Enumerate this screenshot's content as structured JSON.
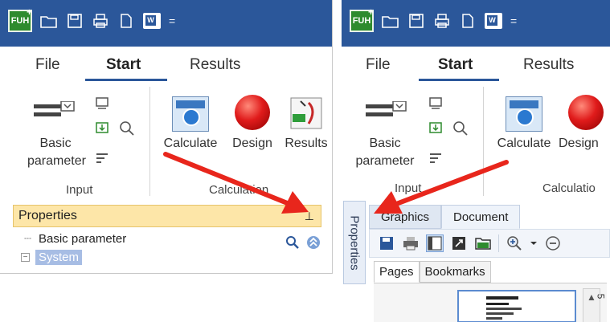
{
  "left": {
    "qat": {
      "logo": "FUH",
      "logo_plus": "+",
      "caret": "="
    },
    "tabs": [
      {
        "label": "File"
      },
      {
        "label": "Start"
      },
      {
        "label": "Results"
      }
    ],
    "ribbon": {
      "basic_parameter": "Basic\nparameter",
      "calculate": "Calculate",
      "design": "Design",
      "results": "Results",
      "group_input": "Input",
      "group_calculation": "Calculation"
    },
    "properties": {
      "title": "Properties",
      "pin": "⊥"
    },
    "tree": {
      "item1": "Basic parameter",
      "item2": "System"
    }
  },
  "right": {
    "qat": {
      "logo": "FUH",
      "logo_plus": "+",
      "caret": "="
    },
    "tabs": [
      {
        "label": "File"
      },
      {
        "label": "Start"
      },
      {
        "label": "Results"
      }
    ],
    "ribbon": {
      "basic_parameter": "Basic\nparameter",
      "calculate": "Calculate",
      "design": "Design",
      "group_input": "Input",
      "group_calculation": "Calculatio"
    },
    "vertical_tab": "Properties",
    "subtabs": [
      {
        "label": "Graphics"
      },
      {
        "label": "Document"
      }
    ],
    "page_tabs": [
      {
        "label": "Pages"
      },
      {
        "label": "Bookmarks"
      }
    ],
    "side_number": "5"
  },
  "colors": {
    "accent": "#2b579a",
    "properties_bar": "#fde6a8",
    "arrow": "#e8261c"
  }
}
